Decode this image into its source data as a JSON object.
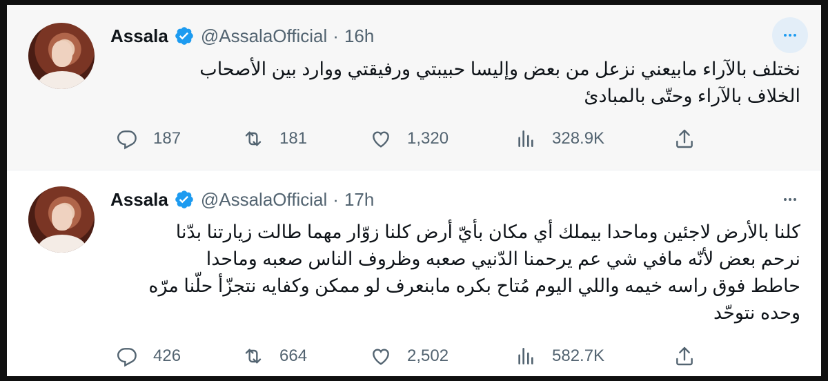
{
  "tweets": [
    {
      "name": "Assala",
      "handle": "@AssalaOfficial",
      "separator": "·",
      "time": "16h",
      "lines": [
        "نختلف بالآراء مابيعني نزعل من بعض وإليسا حبيبتي ورفيقتي ووارد بين الأصحاب",
        "الخلاف بالآراء وحتّى بالمبادئ"
      ],
      "counts": {
        "replies": "187",
        "retweets": "181",
        "likes": "1,320",
        "views": "328.9K"
      },
      "more_highlighted": true
    },
    {
      "name": "Assala",
      "handle": "@AssalaOfficial",
      "separator": "·",
      "time": "17h",
      "lines": [
        "كلنا بالأرض لاجئين وماحدا بيملك أي مكان بأيّ أرض كلنا زوّار مهما طالت زيارتنا بدّنا",
        "نرحم بعض لأنّه مافي شي عم يرحمنا الدّنيي صعبه وظروف الناس صعبه وماحدا",
        "حاطط فوق راسه خيمه واللي اليوم مُتاح بكره مابنعرف لو ممكن وكفايه نتجزّأ حلّنا مرّه",
        "وحده نتوحّد"
      ],
      "counts": {
        "replies": "426",
        "retweets": "664",
        "likes": "2,502",
        "views": "582.7K"
      },
      "more_highlighted": false
    }
  ],
  "icons": {
    "verified": "verified-badge-icon",
    "more": "more-options-icon",
    "reply": "reply-icon",
    "retweet": "retweet-icon",
    "like": "like-icon",
    "views": "views-icon",
    "share": "share-icon"
  },
  "colors": {
    "verified_blue": "#1d9bf0",
    "text_primary": "#0f1419",
    "text_secondary": "#536471"
  }
}
